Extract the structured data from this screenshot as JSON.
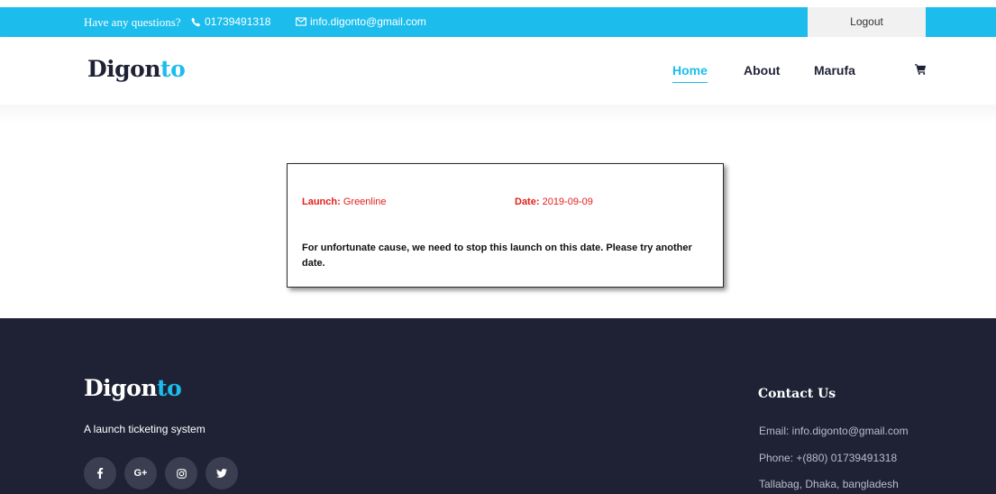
{
  "topbar": {
    "question": "Have any questions?",
    "phone": "01739491318",
    "email": "info.digonto@gmail.com",
    "logout_label": "Logout",
    "bg_color": "#1cbdec"
  },
  "header": {
    "brand_main": "Digon",
    "brand_accent": "to",
    "nav": {
      "home": "Home",
      "about": "About",
      "user": "Marufa"
    },
    "active_nav": "Home",
    "cart_icon": "cart-icon"
  },
  "notice": {
    "launch_label": "Launch:",
    "launch_value": "Greenline",
    "date_label": "Date:",
    "date_value": "2019-09-09",
    "message": "For unfortunate cause, we need to stop this launch on this date. Please try another date."
  },
  "footer": {
    "brand_main": "Digon",
    "brand_accent": "to",
    "tagline": "A launch ticketing system",
    "socials": [
      "facebook-icon",
      "google-plus-icon",
      "instagram-icon",
      "twitter-icon"
    ],
    "contact_title": "Contact Us",
    "contact_email": "Email: info.digonto@gmail.com",
    "contact_phone": "Phone: +(880) 01739491318",
    "contact_address": "Tallabag, Dhaka, bangladesh",
    "bg_color": "#1f2235"
  }
}
